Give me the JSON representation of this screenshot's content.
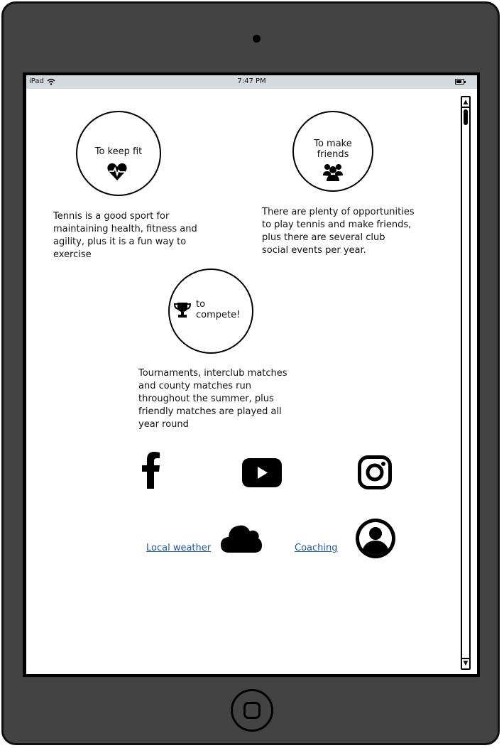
{
  "device": {
    "model": "iPad"
  },
  "status_bar": {
    "device_name": "iPad",
    "time": "7:47 PM"
  },
  "reasons": [
    {
      "title": "To keep fit",
      "icon": "heartbeat-icon",
      "description": "Tennis is a good sport for\nmaintaining health, fitness and\nagility, plus it is a fun way to\nexercise"
    },
    {
      "title": "To make\nfriends",
      "icon": "users-icon",
      "description": "There are plenty of opportunities\nto play tennis and make friends,\nplus there are several club\nsocial events per year."
    },
    {
      "title": "to\ncompete!",
      "icon": "trophy-icon",
      "description": "Tournaments, interclub matches\nand county matches run\nthroughout the summer, plus\nfriendly matches are played all\nyear round"
    }
  ],
  "social": [
    {
      "icon": "facebook-icon"
    },
    {
      "icon": "youtube-icon"
    },
    {
      "icon": "instagram-icon"
    }
  ],
  "links": {
    "weather_label": "Local weather",
    "coaching_label": "Coaching"
  }
}
